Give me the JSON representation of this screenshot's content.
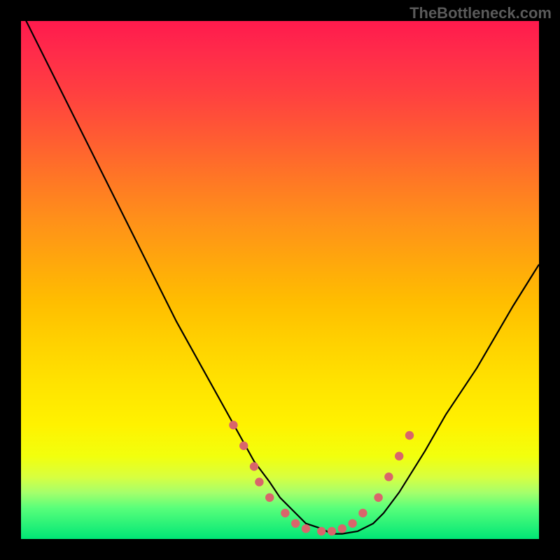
{
  "watermark": "TheBottleneck.com",
  "chart_data": {
    "type": "line",
    "title": "",
    "xlabel": "",
    "ylabel": "",
    "xlim": [
      0,
      100
    ],
    "ylim": [
      0,
      100
    ],
    "grid": false,
    "series": [
      {
        "name": "curve",
        "x": [
          0,
          5,
          10,
          15,
          20,
          25,
          30,
          35,
          40,
          45,
          48,
          50,
          53,
          55,
          58,
          60,
          62,
          65,
          68,
          70,
          73,
          78,
          82,
          88,
          95,
          100
        ],
        "y": [
          102,
          92,
          82,
          72,
          62,
          52,
          42,
          33,
          24,
          15,
          11,
          8,
          5,
          3,
          2,
          1,
          1,
          1.5,
          3,
          5,
          9,
          17,
          24,
          33,
          45,
          53
        ],
        "color": "#000000"
      }
    ],
    "markers": [
      {
        "x": 41,
        "y": 22
      },
      {
        "x": 43,
        "y": 18
      },
      {
        "x": 45,
        "y": 14
      },
      {
        "x": 46,
        "y": 11
      },
      {
        "x": 48,
        "y": 8
      },
      {
        "x": 51,
        "y": 5
      },
      {
        "x": 53,
        "y": 3
      },
      {
        "x": 55,
        "y": 2
      },
      {
        "x": 58,
        "y": 1.5
      },
      {
        "x": 60,
        "y": 1.5
      },
      {
        "x": 62,
        "y": 2
      },
      {
        "x": 64,
        "y": 3
      },
      {
        "x": 66,
        "y": 5
      },
      {
        "x": 69,
        "y": 8
      },
      {
        "x": 71,
        "y": 12
      },
      {
        "x": 73,
        "y": 16
      },
      {
        "x": 75,
        "y": 20
      }
    ],
    "marker_color": "#d9656b"
  }
}
